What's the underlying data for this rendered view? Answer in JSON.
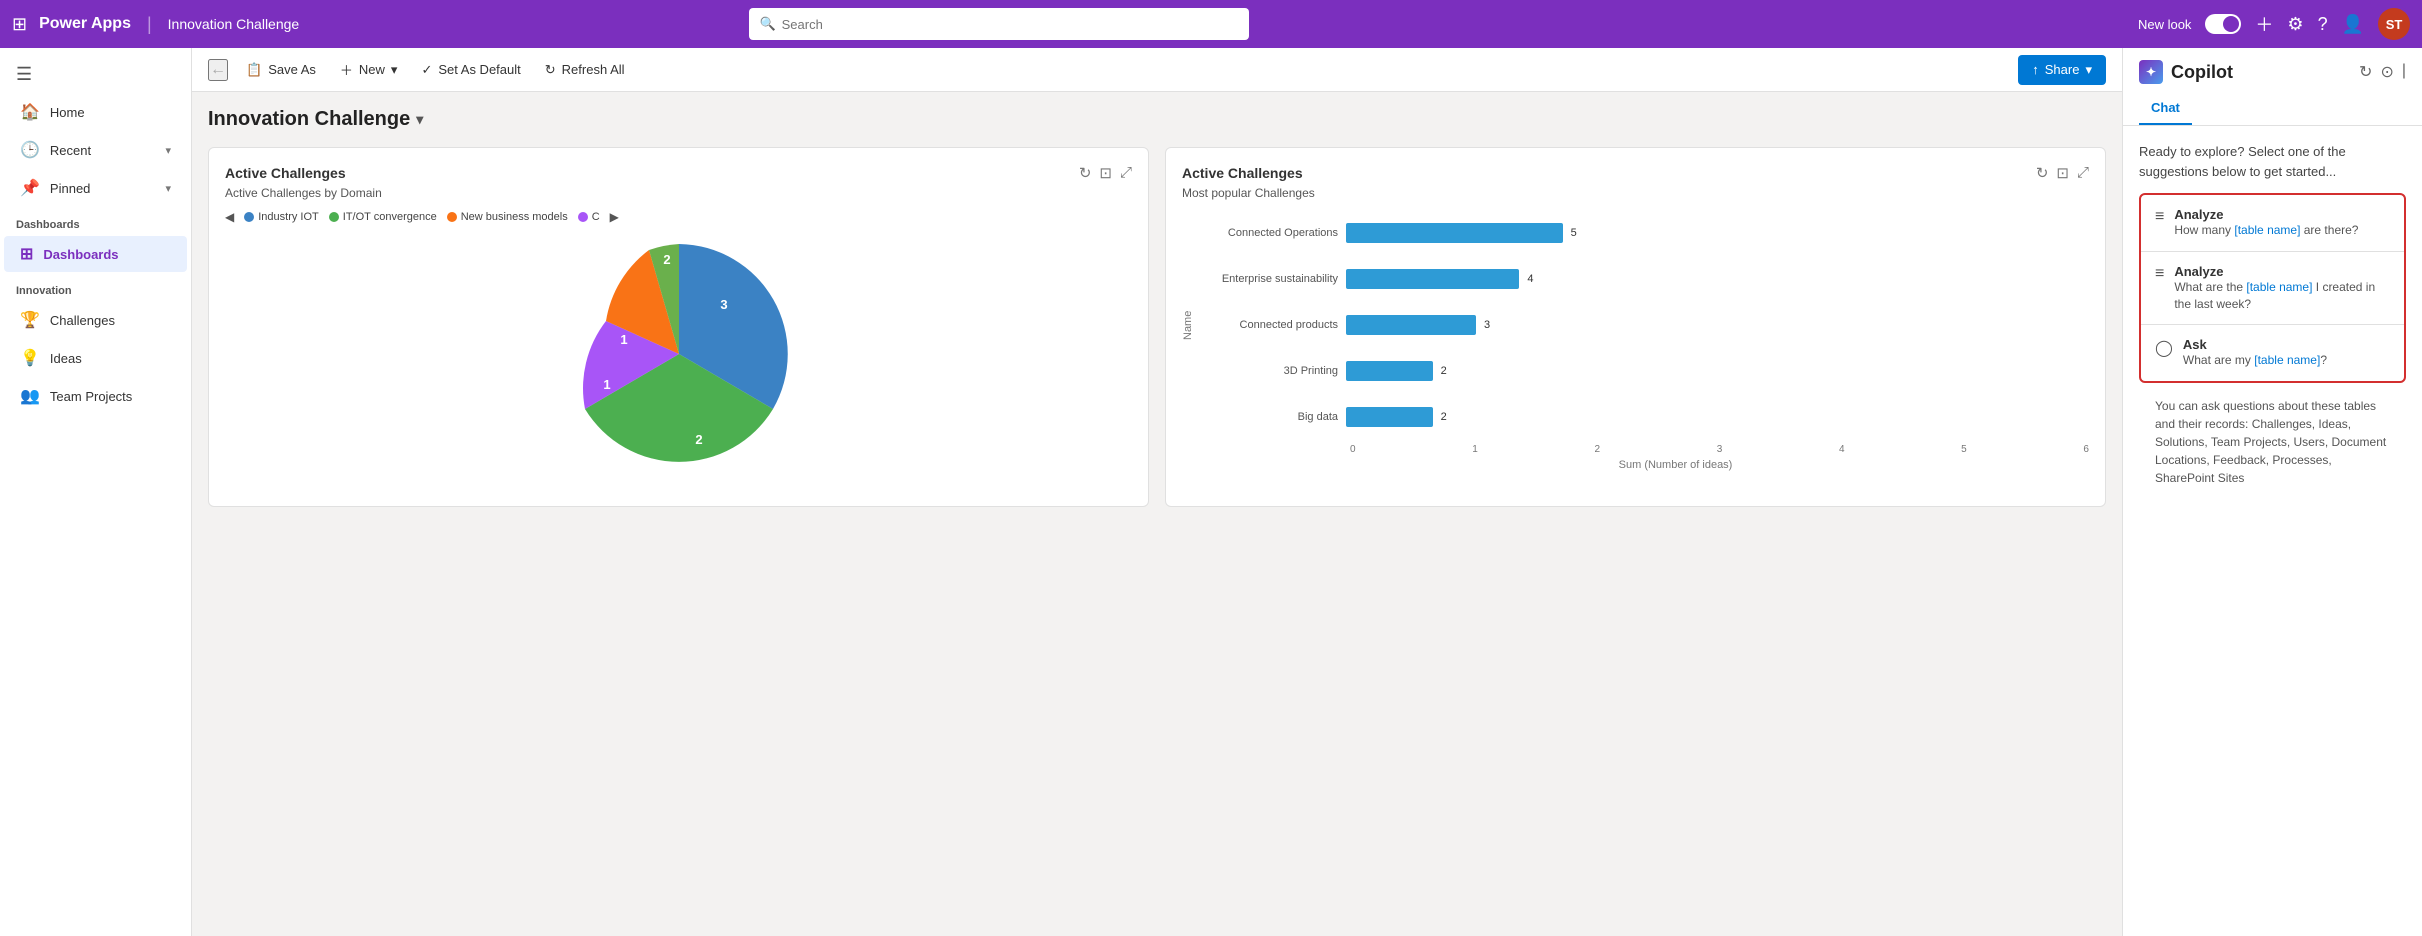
{
  "topNav": {
    "brand": "Power Apps",
    "appName": "Innovation Challenge",
    "searchPlaceholder": "Search",
    "newLook": "New look",
    "avatar": "ST"
  },
  "toolbar": {
    "saveAs": "Save As",
    "new": "New",
    "setAsDefault": "Set As Default",
    "refreshAll": "Refresh All",
    "share": "Share"
  },
  "dashboard": {
    "title": "Innovation Challenge"
  },
  "sidebar": {
    "collapseLabel": "☰",
    "items": [
      {
        "label": "Home",
        "icon": "🏠"
      },
      {
        "label": "Recent",
        "icon": "🕒",
        "chevron": "▾"
      },
      {
        "label": "Pinned",
        "icon": "📌",
        "chevron": "▾"
      }
    ],
    "sections": [
      {
        "label": "Dashboards",
        "items": [
          {
            "label": "Dashboards",
            "icon": "⊞",
            "active": true
          }
        ]
      },
      {
        "label": "Innovation",
        "items": [
          {
            "label": "Challenges",
            "icon": "🏆"
          },
          {
            "label": "Ideas",
            "icon": "💡"
          },
          {
            "label": "Team Projects",
            "icon": "👥"
          }
        ]
      }
    ]
  },
  "pieChart": {
    "title": "Active Challenges",
    "subtitle": "Active Challenges by Domain",
    "legend": [
      {
        "label": "Industry IOT",
        "color": "#3b82c4"
      },
      {
        "label": "IT/OT convergence",
        "color": "#4caf50"
      },
      {
        "label": "New business models",
        "color": "#f97316"
      },
      {
        "label": "C",
        "color": "#a855f7"
      }
    ],
    "slices": [
      {
        "value": 3,
        "color": "#3b82c4",
        "startAngle": 0,
        "endAngle": 108
      },
      {
        "value": 2,
        "color": "#4caf50",
        "startAngle": 108,
        "endAngle": 216
      },
      {
        "value": 1,
        "color": "#a855f7",
        "startAngle": 216,
        "endAngle": 252
      },
      {
        "value": 1,
        "color": "#f97316",
        "startAngle": 252,
        "endAngle": 288
      },
      {
        "value": 2,
        "color": "#6ab04c",
        "startAngle": 288,
        "endAngle": 360
      }
    ],
    "labels": [
      {
        "value": "3",
        "angle": 54
      },
      {
        "value": "2",
        "angle": 162
      },
      {
        "value": "1",
        "angle": 234
      },
      {
        "value": "1",
        "angle": 270
      },
      {
        "value": "2",
        "angle": 324
      }
    ]
  },
  "barChart": {
    "title": "Active Challenges",
    "subtitle": "Most popular Challenges",
    "xAxisLabel": "Sum (Number of ideas)",
    "yAxisLabel": "Name",
    "bars": [
      {
        "label": "Connected Operations",
        "value": 5,
        "maxValue": 6
      },
      {
        "label": "Enterprise sustainability",
        "value": 4,
        "maxValue": 6
      },
      {
        "label": "Connected products",
        "value": 3,
        "maxValue": 6
      },
      {
        "label": "3D Printing",
        "value": 2,
        "maxValue": 6
      },
      {
        "label": "Big data",
        "value": 2,
        "maxValue": 6
      }
    ],
    "xTicks": [
      "0",
      "1",
      "2",
      "3",
      "4",
      "5",
      "6"
    ]
  },
  "copilot": {
    "title": "Copilot",
    "tabs": [
      {
        "label": "Chat",
        "active": true
      }
    ],
    "intro": "Ready to explore? Select one of the suggestions below to get started...",
    "suggestions": [
      {
        "icon": "≡",
        "type": "Analyze",
        "text": "How many ",
        "link": "[table name]",
        "textAfter": " are there?"
      },
      {
        "icon": "≡",
        "type": "Analyze",
        "text": "What are the ",
        "link": "[table name]",
        "textAfter": " I created in the last week?"
      },
      {
        "icon": "◯",
        "type": "Ask",
        "text": "What are my ",
        "link": "[table name]",
        "textAfter": "?"
      }
    ],
    "footer": "You can ask questions about these tables and their records: Challenges, Ideas, Solutions, Team Projects, Users, Document Locations, Feedback, Processes, SharePoint Sites"
  }
}
